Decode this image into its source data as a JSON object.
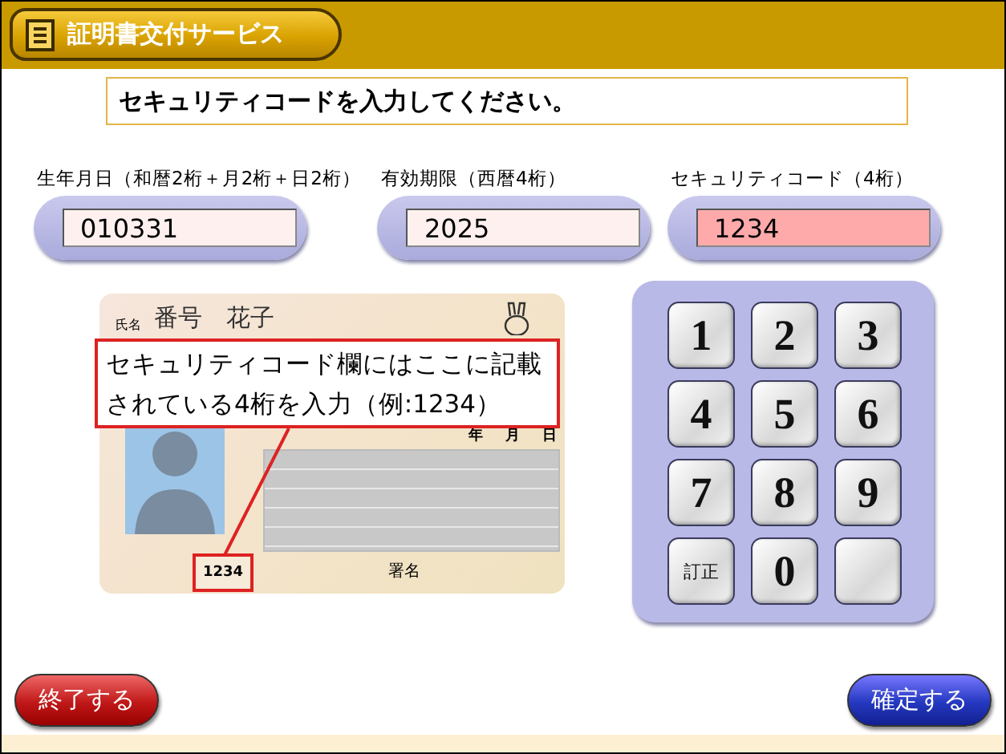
{
  "header": {
    "title": "証明書交付サービス"
  },
  "instruction": "セキュリティコードを入力してください。",
  "fields": [
    {
      "label": "生年月日（和暦2桁＋月2桁＋日2桁）",
      "value": "010331",
      "selected": false
    },
    {
      "label": "有効期限（西暦4桁）",
      "value": "2025",
      "selected": false
    },
    {
      "label": "セキュリティコード（4桁）",
      "value": "1234",
      "selected": true
    }
  ],
  "card": {
    "name_label": "氏名",
    "name": "番号　花子",
    "date_marks": [
      "年",
      "月",
      "日"
    ],
    "signature_label": "署名",
    "security_code": "1234"
  },
  "callout": {
    "lines": [
      "セキュリティコード欄にはここに記載",
      "されている4桁を入力（例:1234）"
    ]
  },
  "keypad": [
    {
      "kind": "digit",
      "label": "1"
    },
    {
      "kind": "digit",
      "label": "2"
    },
    {
      "kind": "digit",
      "label": "3"
    },
    {
      "kind": "digit",
      "label": "4"
    },
    {
      "kind": "digit",
      "label": "5"
    },
    {
      "kind": "digit",
      "label": "6"
    },
    {
      "kind": "digit",
      "label": "7"
    },
    {
      "kind": "digit",
      "label": "8"
    },
    {
      "kind": "digit",
      "label": "9"
    },
    {
      "kind": "text",
      "label": "訂正"
    },
    {
      "kind": "digit",
      "label": "0"
    },
    {
      "kind": "blank"
    }
  ],
  "buttons": [
    {
      "kind": "cancel",
      "label": "終了する"
    },
    {
      "kind": "confirm",
      "label": "確定する"
    }
  ]
}
